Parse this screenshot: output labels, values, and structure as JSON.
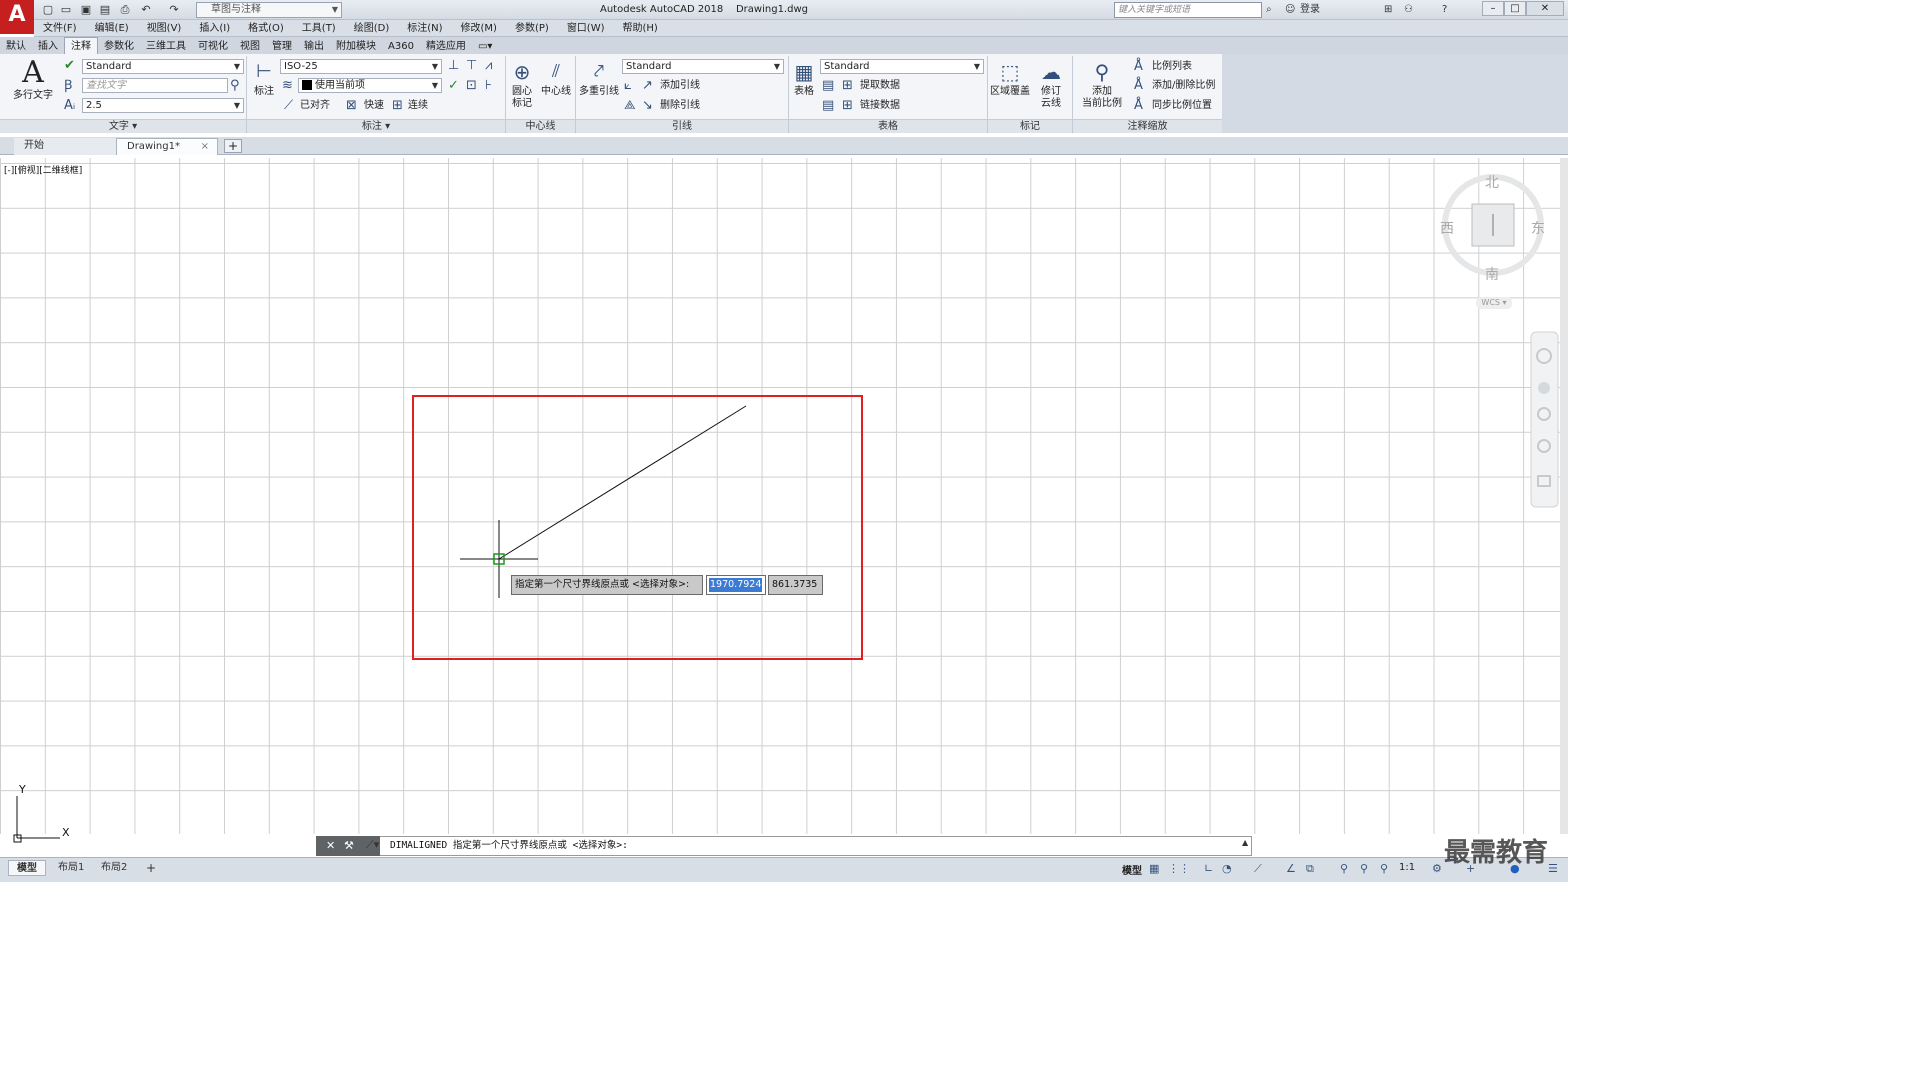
{
  "app": {
    "logo": "A",
    "title": "Autodesk AutoCAD 2018    Drawing1.dwg"
  },
  "quick_access": {
    "workspace": "草图与注释",
    "icons": [
      "new-icon",
      "open-icon",
      "save-icon",
      "saveas-icon",
      "print-icon",
      "undo-icon",
      "redo-icon"
    ]
  },
  "search": {
    "placeholder": "键入关键字或短语"
  },
  "account": {
    "login": "登录"
  },
  "menubar": {
    "items": [
      "文件(F)",
      "编辑(E)",
      "视图(V)",
      "插入(I)",
      "格式(O)",
      "工具(T)",
      "绘图(D)",
      "标注(N)",
      "修改(M)",
      "参数(P)",
      "窗口(W)",
      "帮助(H)"
    ]
  },
  "ribbon_tabs": {
    "items": [
      "默认",
      "插入",
      "注释",
      "参数化",
      "三维工具",
      "可视化",
      "视图",
      "管理",
      "输出",
      "附加模块",
      "A360",
      "精选应用"
    ],
    "active_index": 2
  },
  "ribbon": {
    "text": {
      "title": "文字",
      "multiline_text": "多行文字",
      "style": "Standard",
      "find_placeholder": "查找文字",
      "height": "2.5"
    },
    "dimension": {
      "title": "标注",
      "dim_button": "标注",
      "style": "ISO-25",
      "layer": "使用当前项",
      "aligned": "已对齐",
      "quick": "快速",
      "continue": "连续"
    },
    "centerline": {
      "title": "中心线",
      "center_mark": "圆心\n标记",
      "center_line": "中心线"
    },
    "leader": {
      "title": "引线",
      "multileader": "多重引线",
      "style": "Standard",
      "add": "添加引线",
      "remove": "删除引线"
    },
    "table": {
      "title": "表格",
      "table_button": "表格",
      "style": "Standard",
      "extract": "提取数据",
      "link": "链接数据"
    },
    "markup": {
      "title": "标记",
      "wipeout": "区域覆盖",
      "revcloud_1": "修订",
      "revcloud_2": "云线"
    },
    "annoscale": {
      "title": "注释缩放",
      "add_current_1": "添加",
      "add_current_2": "当前比例",
      "scale_list": "比例列表",
      "add_delete": "添加/删除比例",
      "sync": "同步比例位置"
    }
  },
  "file_tabs": {
    "start": "开始",
    "drawing": "Drawing1*"
  },
  "viewport": {
    "label": "[-][俯视][二维线框]"
  },
  "viewcube": {
    "north": "北",
    "south": "南",
    "east": "东",
    "west": "西",
    "wcs": "WCS"
  },
  "ucs": {
    "x": "X",
    "y": "Y"
  },
  "dynamic_input": {
    "prompt": "指定第一个尺寸界线原点或 <选择对象>:",
    "x_value": "1970.7924",
    "y_value": "861.3735"
  },
  "command_line": {
    "text": "DIMALIGNED 指定第一个尺寸界线原点或 <选择对象>:"
  },
  "layout_tabs": [
    "模型",
    "布局1",
    "布局2"
  ],
  "status": {
    "model": "模型",
    "scale": "1:1"
  },
  "watermark": "最需教育",
  "colors": {
    "highlight_box": "#e02020",
    "accent": "#c61f20"
  }
}
